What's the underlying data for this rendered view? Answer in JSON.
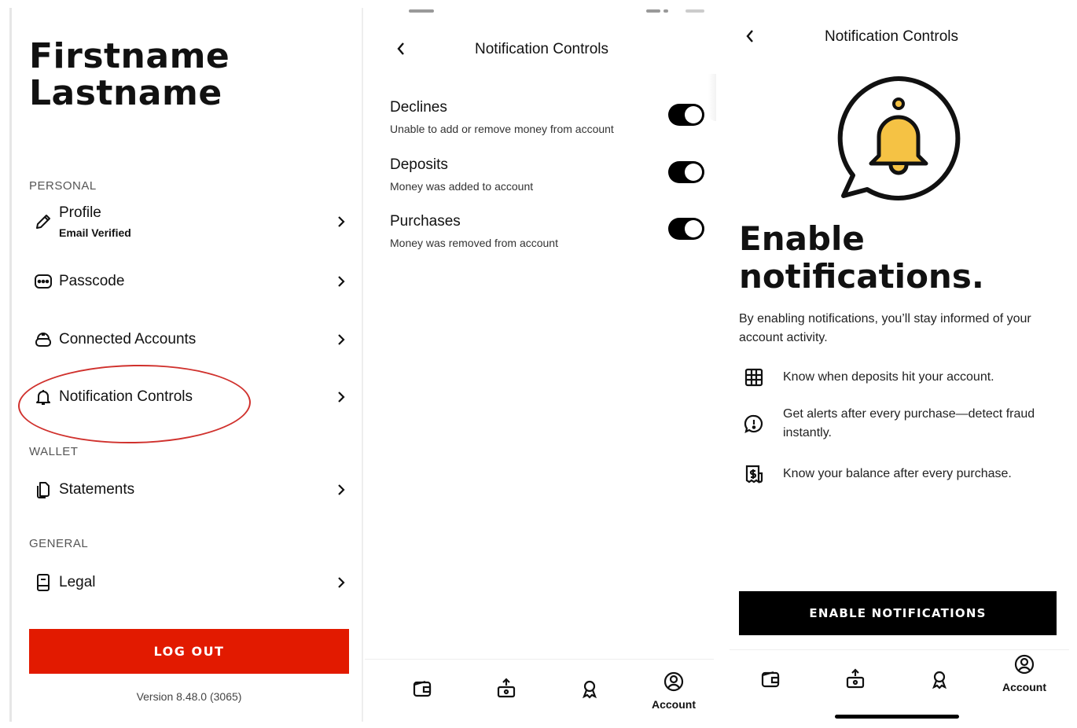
{
  "account_screen": {
    "name_line1": "Firstname",
    "name_line2": "Lastname",
    "sections": {
      "personal": "PERSONAL",
      "wallet": "WALLET",
      "general": "GENERAL"
    },
    "items": {
      "profile": {
        "label": "Profile",
        "sublabel": "Email Verified",
        "icon": "pencil-icon"
      },
      "passcode": {
        "label": "Passcode",
        "icon": "passcode-icon"
      },
      "connected": {
        "label": "Connected Accounts",
        "icon": "connected-accounts-icon"
      },
      "notifications": {
        "label": "Notification Controls",
        "icon": "bell-icon"
      },
      "statements": {
        "label": "Statements",
        "icon": "documents-icon"
      },
      "legal": {
        "label": "Legal",
        "icon": "book-icon"
      }
    },
    "logout_label": "LOG OUT",
    "version": "Version 8.48.0 (3065)",
    "accent_color": "#e21a00",
    "highlight_color": "#d0312d"
  },
  "controls_screen": {
    "title": "Notification Controls",
    "toggles": [
      {
        "title": "Declines",
        "description": "Unable to add or remove money from account",
        "on": true
      },
      {
        "title": "Deposits",
        "description": "Money was added to account",
        "on": true
      },
      {
        "title": "Purchases",
        "description": "Money was removed from account",
        "on": true
      }
    ],
    "tab_account_label": "Account"
  },
  "enable_screen": {
    "title": "Notification Controls",
    "hero_line1": "Enable",
    "hero_line2": "notifications.",
    "description": "By enabling notifications, you’ll stay informed of your account activity.",
    "features": [
      {
        "text": "Know when deposits hit your account.",
        "icon": "deposit-grid-icon"
      },
      {
        "text": "Get alerts after every purchase—detect fraud instantly.",
        "icon": "alert-bubble-icon"
      },
      {
        "text": "Know your balance after every purchase.",
        "icon": "receipt-dollar-icon"
      }
    ],
    "button_label": "ENABLE NOTIFICATIONS",
    "tab_account_label": "Account",
    "bell_color": "#f5c244"
  }
}
